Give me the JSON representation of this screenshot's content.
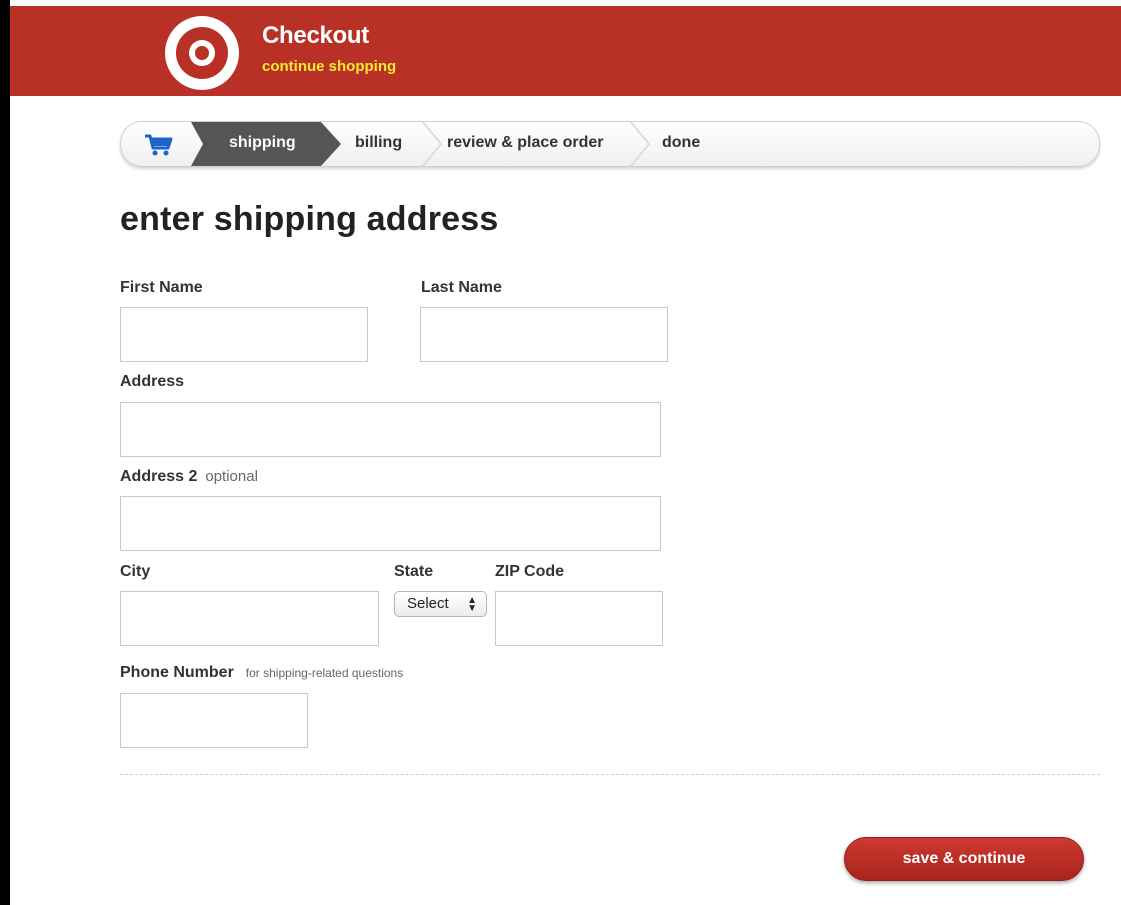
{
  "header": {
    "title": "Checkout",
    "continue_link": "continue shopping"
  },
  "progress": {
    "steps": [
      {
        "label": "shipping",
        "active": true
      },
      {
        "label": "billing",
        "active": false
      },
      {
        "label": "review & place order",
        "active": false
      },
      {
        "label": "done",
        "active": false
      }
    ]
  },
  "form": {
    "heading": "enter shipping address",
    "first_name_label": "First Name",
    "first_name_value": "",
    "last_name_label": "Last Name",
    "last_name_value": "",
    "address_label": "Address",
    "address_value": "",
    "address2_label": "Address 2",
    "address2_hint": "optional",
    "address2_value": "",
    "city_label": "City",
    "city_value": "",
    "state_label": "State",
    "state_selected": "Select",
    "zip_label": "ZIP Code",
    "zip_value": "",
    "phone_label": "Phone Number",
    "phone_hint": "for shipping-related questions",
    "phone_value": ""
  },
  "actions": {
    "save_label": "save & continue"
  },
  "colors": {
    "brand_red": "#b93027",
    "link_yellow": "#f7ea2e",
    "active_step": "#555555",
    "cart_blue": "#1e63c7"
  },
  "icons": {
    "logo": "target-bullseye-logo",
    "cart": "shopping-cart-icon",
    "select_arrows": "updown-arrows-icon"
  }
}
